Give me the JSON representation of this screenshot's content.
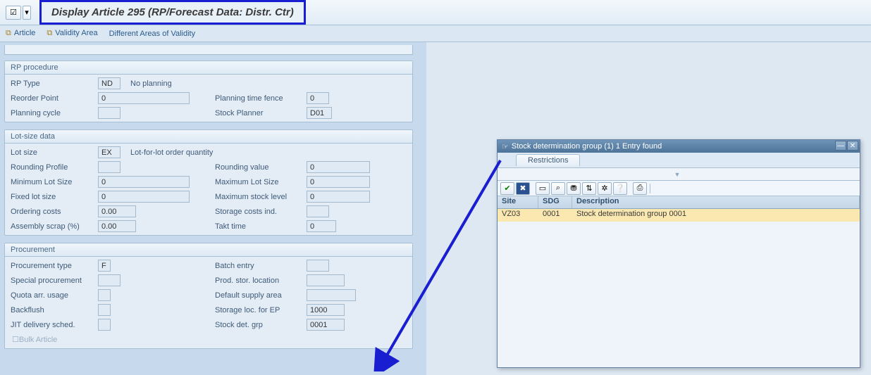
{
  "topbar": {
    "title": "Display Article 295 (RP/Forecast Data: Distr. Ctr)"
  },
  "toolbar2": {
    "article": "Article",
    "validity": "Validity Area",
    "diff": "Different Areas of Validity"
  },
  "rp": {
    "group_title": "RP procedure",
    "type_label": "RP Type",
    "type_value": "ND",
    "type_desc": "No planning",
    "reorder_label": "Reorder Point",
    "reorder_value": "0",
    "cycle_label": "Planning cycle",
    "cycle_value": "",
    "fence_label": "Planning time fence",
    "fence_value": "0",
    "planner_label": "Stock Planner",
    "planner_value": "D01"
  },
  "lot": {
    "group_title": "Lot-size data",
    "size_label": "Lot size",
    "size_value": "EX",
    "size_desc": "Lot-for-lot order quantity",
    "profile_label": "Rounding Profile",
    "profile_value": "",
    "rval_label": "Rounding value",
    "rval_value": "0",
    "min_label": "Minimum Lot Size",
    "min_value": "0",
    "max_label": "Maximum Lot Size",
    "max_value": "0",
    "fixed_label": "Fixed lot size",
    "fixed_value": "0",
    "maxstock_label": "Maximum stock level",
    "maxstock_value": "0",
    "ord_label": "Ordering costs",
    "ord_value": "0.00",
    "stor_label": "Storage costs ind.",
    "stor_value": "",
    "scrap_label": "Assembly scrap (%)",
    "scrap_value": "0.00",
    "takt_label": "Takt time",
    "takt_value": "0"
  },
  "proc": {
    "group_title": "Procurement",
    "type_label": "Procurement type",
    "type_value": "F",
    "special_label": "Special procurement",
    "special_value": "",
    "quota_label": "Quota arr. usage",
    "quota_value": "",
    "backflush_label": "Backflush",
    "backflush_value": "",
    "jit_label": "JIT delivery sched.",
    "jit_value": "",
    "batch_label": "Batch entry",
    "batch_value": "",
    "pstor_label": "Prod. stor. location",
    "pstor_value": "",
    "supply_label": "Default supply area",
    "supply_value": "",
    "ep_label": "Storage loc. for EP",
    "ep_value": "1000",
    "grp_label": "Stock det. grp",
    "grp_value": "0001",
    "bulk": "Bulk Article"
  },
  "popup": {
    "title_icon": "☞",
    "title": "Stock determination group (1)    1 Entry found",
    "tab": "Restrictions",
    "hdr_site": "Site",
    "hdr_sdg": "SDG",
    "hdr_desc": "Description",
    "row_site": "VZ03",
    "row_sdg": "0001",
    "row_desc": "Stock determination group 0001"
  }
}
